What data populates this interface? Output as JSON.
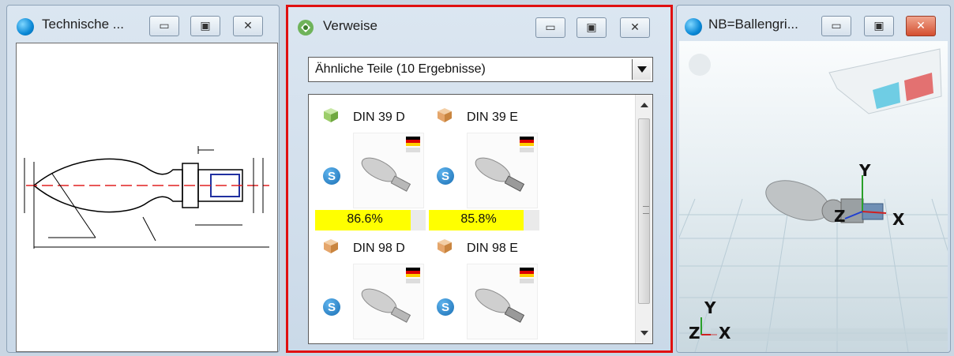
{
  "windows": {
    "drawing": {
      "title": "Technische ..."
    },
    "references": {
      "title": "Verweise",
      "dropdown_value": "Ähnliche Teile (10 Ergebnisse)",
      "results": [
        {
          "name": "DIN 39 D",
          "match": "86.6%",
          "match_fraction": 0.866,
          "badge": "S",
          "cube_color": "#9ccd6a"
        },
        {
          "name": "DIN 39 E",
          "match": "85.8%",
          "match_fraction": 0.858,
          "badge": "S",
          "cube_color": "#e5a66b"
        },
        {
          "name": "DIN 98 D",
          "badge": "S",
          "cube_color": "#e5a66b"
        },
        {
          "name": "DIN 98 E",
          "badge": "S",
          "cube_color": "#e5a66b"
        }
      ]
    },
    "viewer": {
      "title": "NB=Ballengri...",
      "axes": {
        "y": "Y",
        "z": "Z",
        "x": "X"
      },
      "mini_axes": {
        "y": "Y",
        "z": "Z",
        "x": "X"
      }
    }
  },
  "window_buttons": {
    "minimize": "▭",
    "maximize": "▣",
    "close": "✕"
  },
  "colors": {
    "highlight_border": "#e01010",
    "match_bar": "#ffff00"
  }
}
